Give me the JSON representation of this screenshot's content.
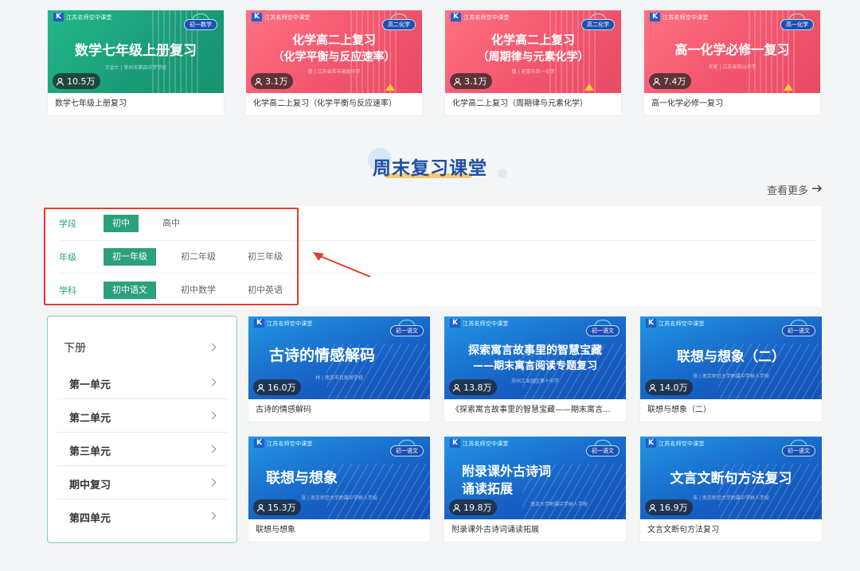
{
  "top_courses": [
    {
      "title": "数学七年级上册复习",
      "banner": "数学七年级上册复习",
      "banner2": "",
      "subject_tag": "初一数学",
      "teacher": "王金亡 | 常州市第四中学学校",
      "views": "10.5万",
      "theme": "green"
    },
    {
      "title": "化学高二上复习（化学平衡与反应速率）",
      "banner": "化学高二上复习",
      "banner2": "（化学平衡与反应速率）",
      "subject_tag": "高二化学",
      "teacher": "曹 | 江苏省梁丰高级中学",
      "views": "3.1万",
      "theme": "pink"
    },
    {
      "title": "化学高二上复习（周期律与元素化学）",
      "banner": "化学高二上复习",
      "banner2": "（周期律与元素化学）",
      "subject_tag": "高二化学",
      "teacher": "曹 | 无锡市第一中学",
      "views": "3.1万",
      "theme": "pink"
    },
    {
      "title": "高一化学必修一复习",
      "banner": "高一化学必修一复习",
      "banner2": "",
      "subject_tag": "高一化学",
      "teacher": "王家 | 江苏省锡山中学",
      "views": "7.4万",
      "theme": "pink"
    }
  ],
  "brand_text": "江苏名师空中课堂",
  "section": {
    "title": "周末复习课堂",
    "more_label": "查看更多"
  },
  "filters": [
    {
      "label": "学段",
      "options": [
        "初中",
        "高中"
      ],
      "active": 0
    },
    {
      "label": "年级",
      "options": [
        "初一年级",
        "初二年级",
        "初三年级"
      ],
      "active": 0
    },
    {
      "label": "学科",
      "options": [
        "初中语文",
        "初中数学",
        "初中英语"
      ],
      "active": 0
    }
  ],
  "sidebar": {
    "heading": "下册",
    "items": [
      "第一单元",
      "第二单元",
      "第三单元",
      "期中复习",
      "第四单元"
    ]
  },
  "grid_courses": [
    {
      "title": "古诗的情感解码",
      "banner": "古诗的情感解码",
      "banner2": "",
      "subject_tag": "初一语文",
      "teacher": "林 | 南京市百家湖学校",
      "views": "16.0万"
    },
    {
      "title": "《探索寓言故事里的智慧宝藏——期末寓言...",
      "banner": "探索寓言故事里的智慧宝藏",
      "banner2": "——期末寓言阅读专题复习",
      "subject_tag": "初一语文",
      "teacher": "苏州工业园区第十中学",
      "views": "13.8万"
    },
    {
      "title": "联想与想象（二）",
      "banner": "联想与想象（二）",
      "banner2": "",
      "subject_tag": "初一语文",
      "teacher": "张 | 南京师范大学附属中学树人学校",
      "views": "14.0万"
    },
    {
      "title": "联想与想象",
      "banner": "联想与想象",
      "banner2": "",
      "subject_tag": "初一语文",
      "teacher": "张 | 南京师范大学附属中学树人学校",
      "views": "15.3万"
    },
    {
      "title": "附录课外古诗词诵读拓展",
      "banner": "附录课外古诗词",
      "banner2": "诵读拓展",
      "subject_tag": "初一语文",
      "teacher": "南京大学附属中学树人学校",
      "views": "19.8万"
    },
    {
      "title": "文言文断句方法复习",
      "banner": "文言文断句方法复习",
      "banner2": "",
      "subject_tag": "初一语文",
      "teacher": "朱 | 南京师范大学附属中学树人学校",
      "views": "16.9万"
    }
  ],
  "colors": {
    "accent_green": "#2c9f7e",
    "title_blue": "#1f4ea5",
    "highlight_red": "#e33b2f"
  },
  "icons": {
    "views": "user-icon",
    "more": "arrow-right-icon",
    "sidebar": "chevron-right-icon"
  }
}
